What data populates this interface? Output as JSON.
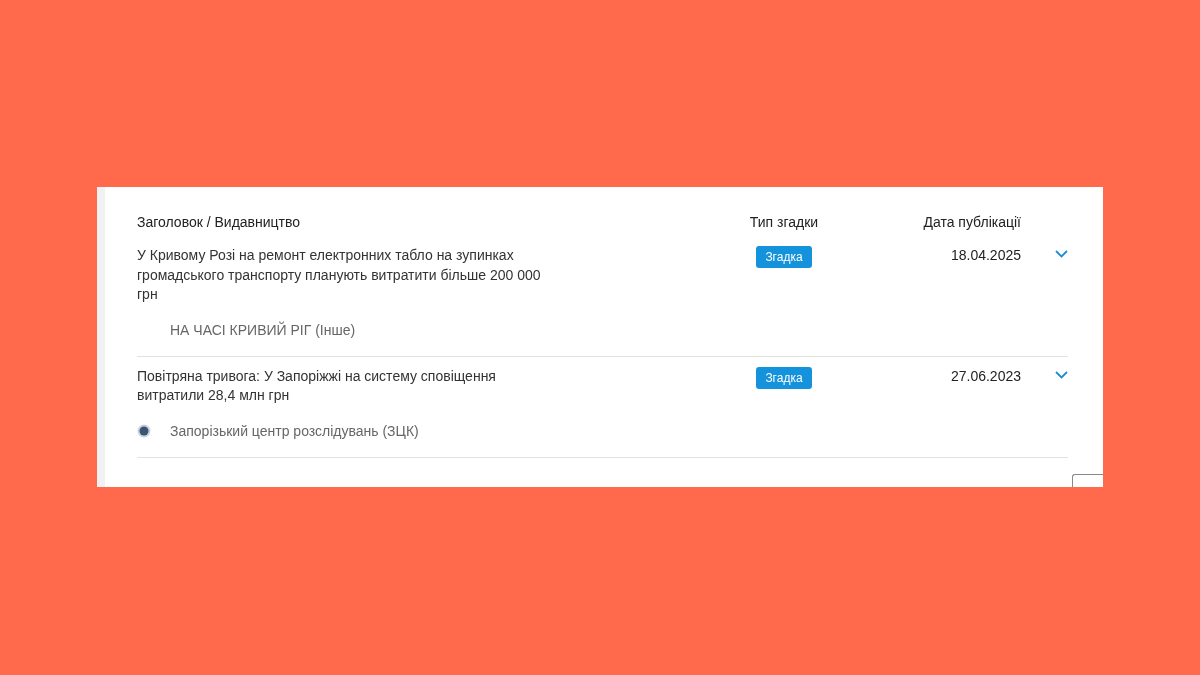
{
  "table": {
    "columns": [
      "Заголовок / Видавництво",
      "Тип згадки",
      "Дата публікації"
    ],
    "rows": [
      {
        "title": "У Кривому Розі на ремонт електронних табло на зупинках громадського транспорту планують витратити більше 200 000 грн",
        "publisher": "НА ЧАСІ КРИВИЙ РІГ (Інше)",
        "publisher_logo": false,
        "mention_type": "Згадка",
        "date": "18.04.2025",
        "expanded": false
      },
      {
        "title": "Повітряна тривога: У Запоріжжі на систему сповіщення витратили 28,4 млн грн",
        "publisher": "Запорізький центр розслідувань (ЗЦК)",
        "publisher_logo": true,
        "mention_type": "Згадка",
        "date": "27.06.2023",
        "expanded": false
      }
    ]
  }
}
